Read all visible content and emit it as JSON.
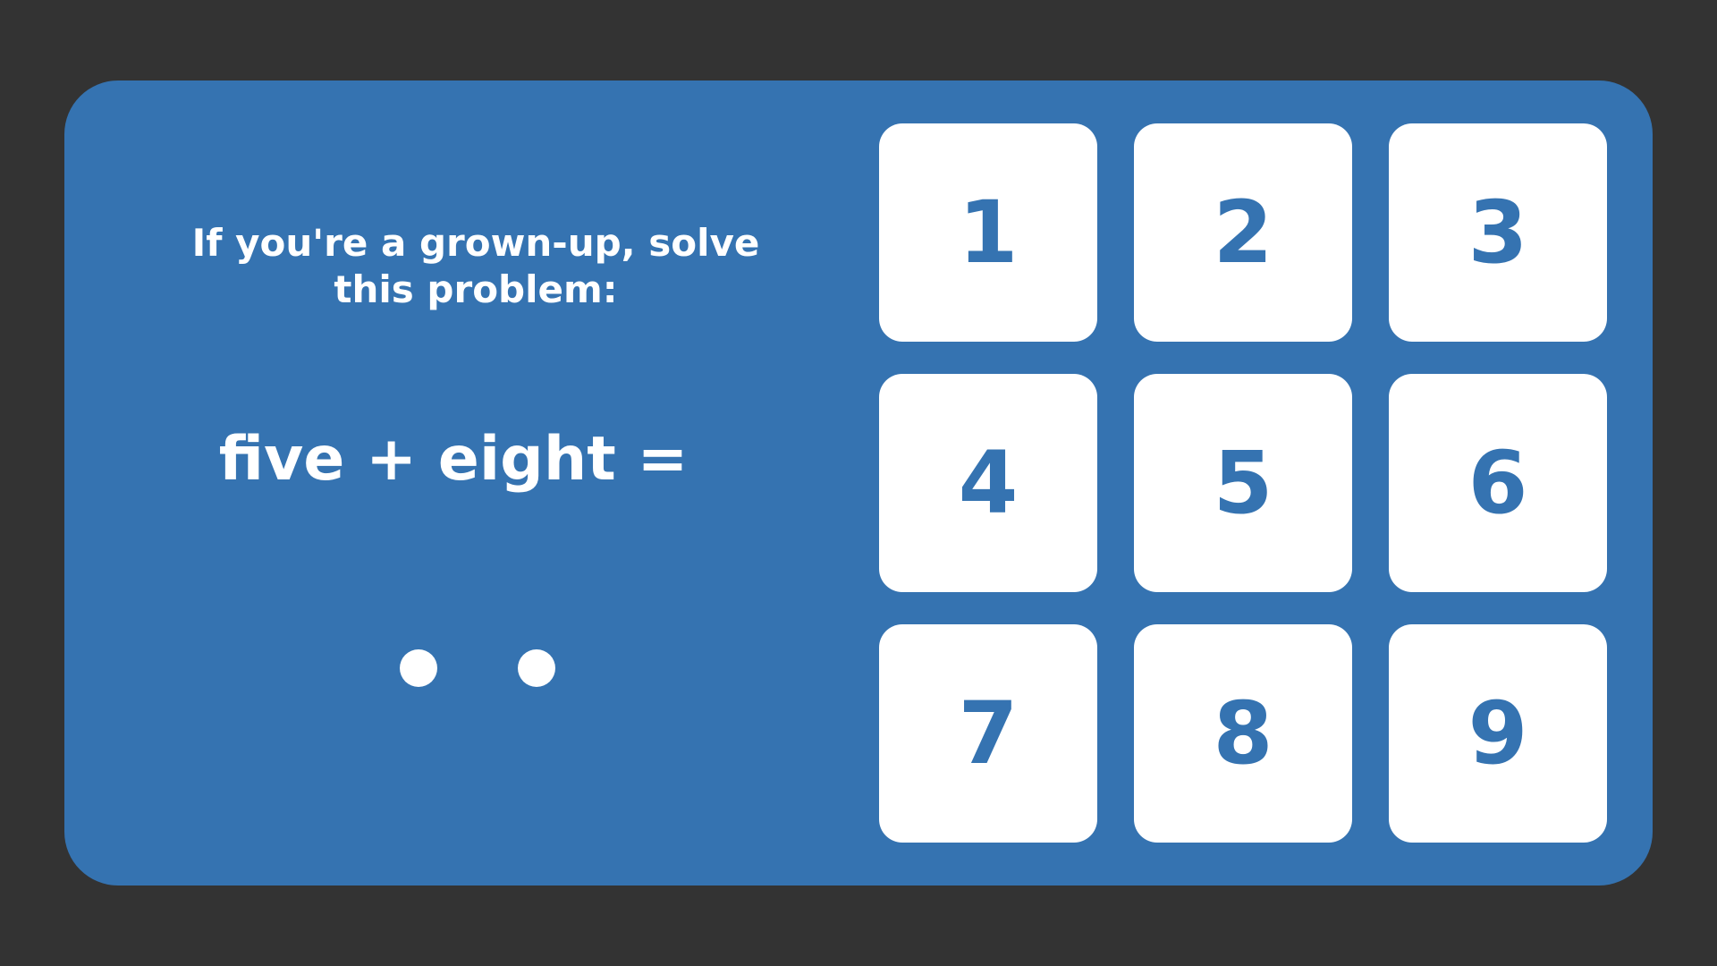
{
  "colors": {
    "background": "#333333",
    "panel": "#3573b1",
    "key_background": "#ffffff",
    "key_text": "#3573b1",
    "text": "#ffffff"
  },
  "gate": {
    "prompt": "If you're a grown-up, solve this problem:",
    "equation": "five + eight =",
    "answer_dots_count": 2
  },
  "keypad": {
    "keys": [
      "1",
      "2",
      "3",
      "4",
      "5",
      "6",
      "7",
      "8",
      "9"
    ]
  }
}
